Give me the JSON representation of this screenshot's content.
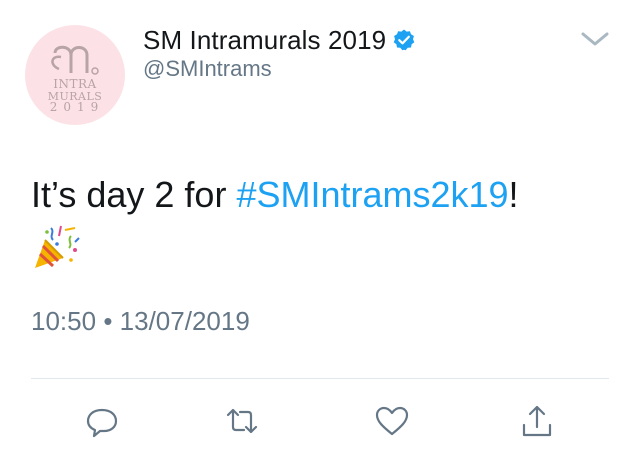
{
  "tweet": {
    "author": {
      "display_name": "SM Intramurals 2019",
      "handle": "@SMIntrams",
      "verified": true,
      "avatar": {
        "logo_text_line1": "INTRA",
        "logo_text_line2": "MURALS",
        "logo_text_line3": "2019",
        "background_color": "#fce2e6"
      }
    },
    "text_before": "It’s day 2 for ",
    "hashtag": "#SMIntrams2k19",
    "text_after": "!",
    "emoji": "party-popper-icon",
    "time": "10:50",
    "separator": "•",
    "date": "13/07/2019"
  },
  "icons": {
    "menu": "chevron-down-icon",
    "reply": "reply-icon",
    "retweet": "retweet-icon",
    "like": "heart-icon",
    "share": "share-icon"
  },
  "colors": {
    "text": "#14171a",
    "secondary": "#657786",
    "link": "#1da1f2",
    "icon": "#657786",
    "divider": "#e1e8ed",
    "verified": "#1da1f2"
  }
}
